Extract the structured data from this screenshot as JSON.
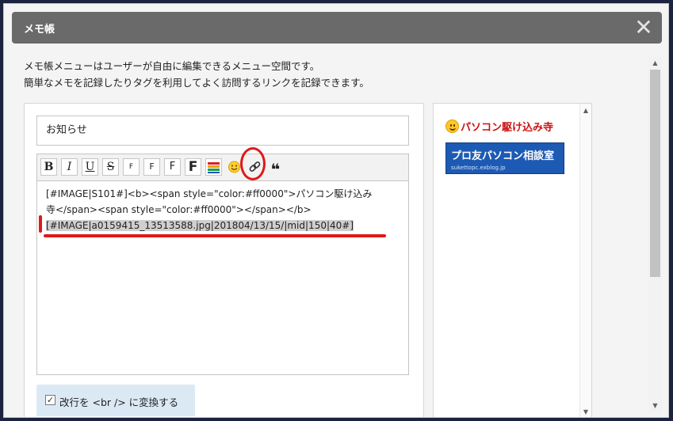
{
  "dialog": {
    "title": "メモ帳",
    "close_glyph": "✕",
    "description_line1": "メモ帳メニューはユーザーが自由に編集できるメニュー空間です。",
    "description_line2": "簡単なメモを記録したりタグを利用してよく訪問するリンクを記録できます。"
  },
  "editor": {
    "subject_value": "お知らせ",
    "toolbar": {
      "bold": "B",
      "italic": "I",
      "underline": "U",
      "strike": "S",
      "font_size_1": "F",
      "font_size_2": "F",
      "font_size_3": "F",
      "font_size_4": "F",
      "quote": "❝"
    },
    "content_line1": "[#IMAGE|S101#]<b><span style=\"color:#ff0000\">パソコン駆け込み",
    "content_line2": "寺</span><span style=\"color:#ff0000\"></span></b>",
    "content_line3_selected": "[#IMAGE|a0159415_13513588.jpg|201804/13/15/|mid|150|40#]"
  },
  "options": {
    "linebreak_checked": true,
    "check_glyph": "✓",
    "linebreak_label": "改行を <br /> に変換する"
  },
  "preview": {
    "title": "パソコン駆け込み寺",
    "banner_main": "プロ友パソコン相談室",
    "banner_sub": "sukettopc.exblog.jp"
  },
  "scroll": {
    "up_glyph": "▲",
    "down_glyph": "▼"
  },
  "colors": {
    "annotation_red": "#e01818",
    "titlebar_bg": "#6a6a6a",
    "preview_title": "#cc1111",
    "banner_bg": "#1c5ab4"
  }
}
